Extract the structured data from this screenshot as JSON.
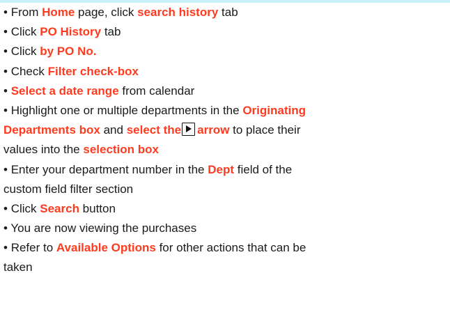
{
  "bullet": "•",
  "steps": [
    {
      "lines": [
        [
          "From ",
          {
            "h": "Home"
          },
          " page, click ",
          {
            "h": "search history"
          },
          " tab"
        ]
      ]
    },
    {
      "lines": [
        [
          "Click ",
          {
            "h": "PO History"
          },
          " tab"
        ]
      ]
    },
    {
      "lines": [
        [
          "Click ",
          {
            "h": "by PO No."
          }
        ]
      ]
    },
    {
      "lines": [
        [
          "Check ",
          {
            "h": "Filter check-box"
          }
        ]
      ]
    },
    {
      "lines": [
        [
          {
            "h": "Select a date range"
          },
          " from calendar"
        ]
      ]
    },
    {
      "lines": [
        [
          "Highlight one or multiple departments in the ",
          {
            "h": "Originating"
          }
        ],
        [
          {
            "h": "Departments box"
          },
          " and ",
          {
            "h": "select the"
          },
          {
            "icon": "right-arrow-icon"
          },
          {
            "h": "arrow"
          },
          " to place their"
        ],
        [
          "values into the ",
          {
            "h": "selection box"
          }
        ]
      ]
    },
    {
      "lines": [
        [
          "Enter your department number in the ",
          {
            "h": "Dept"
          },
          " field of the"
        ],
        [
          "custom field filter section"
        ]
      ]
    },
    {
      "lines": [
        [
          "Click ",
          {
            "h": "Search"
          },
          " button"
        ]
      ]
    },
    {
      "lines": [
        [
          "You are now viewing the purchases"
        ]
      ]
    },
    {
      "lines": [
        [
          "Refer to ",
          {
            "h": "Available Options"
          },
          " for other actions that can be"
        ],
        [
          "taken"
        ]
      ]
    }
  ],
  "colors": {
    "highlight": "#ff3b1f",
    "text": "#1a1a1a",
    "band": "#c9f0fb"
  }
}
